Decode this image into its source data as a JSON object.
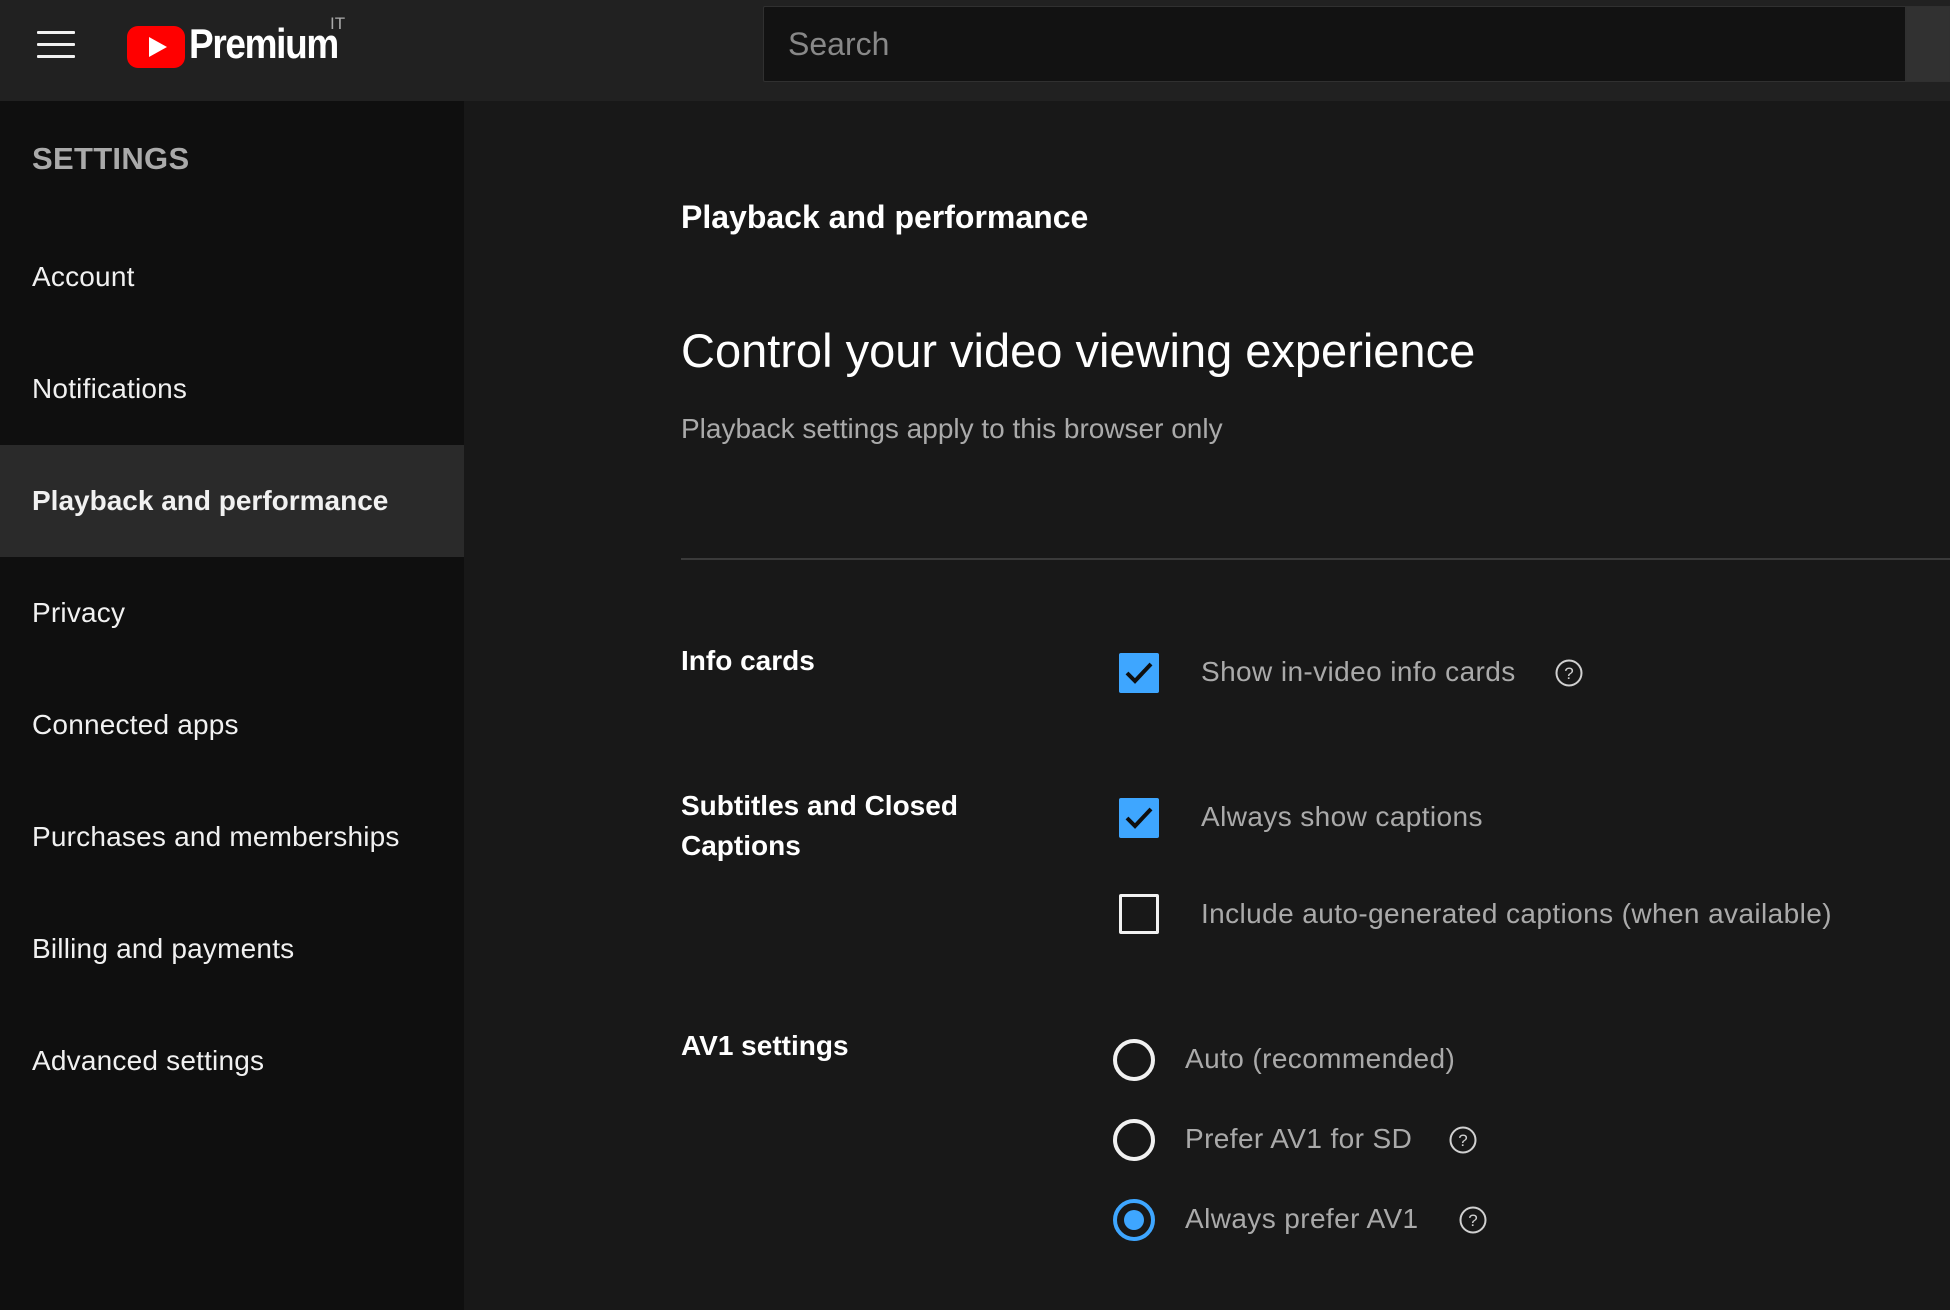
{
  "header": {
    "logo_text": "Premium",
    "country_code": "IT",
    "search_placeholder": "Search"
  },
  "sidebar": {
    "heading": "SETTINGS",
    "items": [
      {
        "label": "Account",
        "active": false
      },
      {
        "label": "Notifications",
        "active": false
      },
      {
        "label": "Playback and performance",
        "active": true
      },
      {
        "label": "Privacy",
        "active": false
      },
      {
        "label": "Connected apps",
        "active": false
      },
      {
        "label": "Purchases and memberships",
        "active": false
      },
      {
        "label": "Billing and payments",
        "active": false
      },
      {
        "label": "Advanced settings",
        "active": false
      }
    ]
  },
  "main": {
    "section_title": "Playback and performance",
    "heading": "Control your video viewing experience",
    "subtitle": "Playback settings apply to this browser only",
    "info_cards": {
      "label": "Info cards",
      "option": "Show in-video info cards",
      "checked": true
    },
    "captions": {
      "label": "Subtitles and Closed Captions",
      "options": [
        {
          "label": "Always show captions",
          "checked": true
        },
        {
          "label": "Include auto-generated captions (when available)",
          "checked": false
        }
      ]
    },
    "av1": {
      "label": "AV1 settings",
      "options": [
        {
          "label": "Auto (recommended)",
          "selected": false
        },
        {
          "label": "Prefer AV1 for SD",
          "selected": false
        },
        {
          "label": "Always prefer AV1",
          "selected": true
        }
      ]
    }
  },
  "colors": {
    "accent": "#3ea6ff",
    "brand_red": "#ff0000",
    "background": "#181818",
    "sidebar": "#0f0f0f",
    "masthead": "#212121"
  },
  "icons": [
    "menu-icon",
    "youtube-logo",
    "help-icon",
    "checkmark-icon"
  ]
}
